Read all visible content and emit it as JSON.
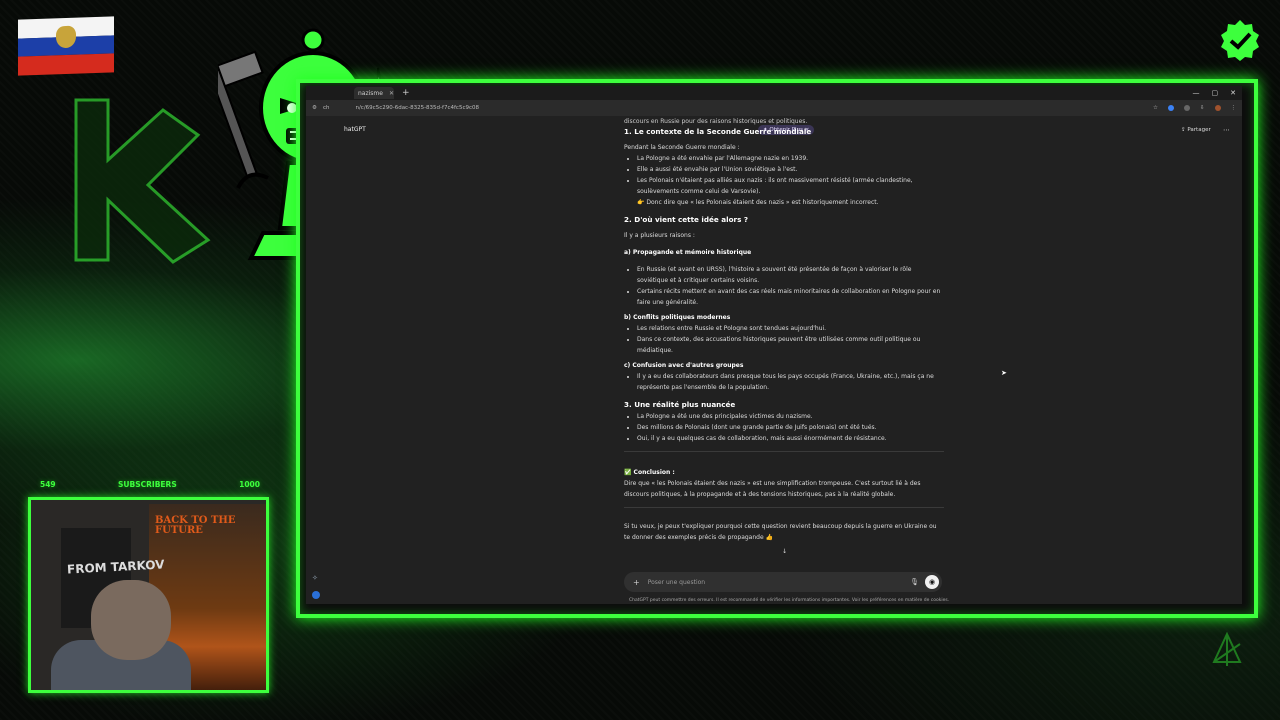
{
  "stream": {
    "subscribers_current": "549",
    "subscribers_label": "SUBSCRIBERS",
    "subscribers_goal": "1000",
    "poster_right_title": "BACK TO THE FUTURE",
    "poster_left_title": "FROM TARKOV"
  },
  "browser": {
    "tab_title": "nazisme",
    "new_tab": "+",
    "url": "n/c/69c5c290-6dac-8325-835d-f7c4fc5c9c08",
    "window_controls": [
      "—",
      "▢",
      "✕"
    ]
  },
  "chat": {
    "app_label": "hatGPT",
    "obtenir_plus": "Obtenir Plus",
    "share_label": "Partager",
    "top_line": "discours en Russie pour des raisons historiques et politiques.",
    "sections": [
      {
        "title": "1. Le contexte de la Seconde Guerre mondiale"
      }
    ],
    "s1_intro": "Pendant la Seconde Guerre mondiale :",
    "s1_items": [
      "La Pologne a été envahie par l'Allemagne nazie en 1939.",
      "Elle a aussi été envahie par l'Union soviétique à l'est.",
      "Les Polonais n'étaient pas alliés aux nazis : ils ont massivement résisté (armée clandestine, soulèvements comme celui de Varsovie).",
      "👉 Donc dire que « les Polonais étaient des nazis » est historiquement incorrect."
    ],
    "s2_title": "2. D'où vient cette idée alors ?",
    "s2_intro": "Il y a plusieurs raisons :",
    "s2a_title": "a) Propagande et mémoire historique",
    "s2a_items": [
      "En Russie (et avant en URSS), l'histoire a souvent été présentée de façon à valoriser le rôle soviétique et à critiquer certains voisins.",
      "Certains récits mettent en avant des cas réels mais minoritaires de collaboration en Pologne pour en faire une généralité."
    ],
    "s2b_title": "b) Conflits politiques modernes",
    "s2b_items": [
      "Les relations entre Russie et Pologne sont tendues aujourd'hui.",
      "Dans ce contexte, des accusations historiques peuvent être utilisées comme outil politique ou médiatique."
    ],
    "s2c_title": "c) Confusion avec d'autres groupes",
    "s2c_items": [
      "Il y a eu des collaborateurs dans presque tous les pays occupés (France, Ukraine, etc.), mais ça ne représente pas l'ensemble de la population."
    ],
    "s3_title": "3. Une réalité plus nuancée",
    "s3_items": [
      "La Pologne a été une des principales victimes du nazisme.",
      "Des millions de Polonais (dont une grande partie de Juifs polonais) ont été tués.",
      "Oui, il y a eu quelques cas de collaboration, mais aussi énormément de résistance."
    ],
    "conclusion_title": "✅ Conclusion :",
    "conclusion_text": "Dire que « les Polonais étaient des nazis » est une simplification trompeuse. C'est surtout lié à des discours politiques, à la propagande et à des tensions historiques, pas à la réalité globale.",
    "followup": "Si tu veux, je peux t'expliquer pourquoi cette question revient beaucoup depuis la guerre en Ukraine ou te donner des exemples précis de propagande 👍",
    "input_placeholder": "Poser une question",
    "disclaimer": "ChatGPT peut commettre des erreurs. Il est recommandé de vérifier les informations importantes. Voir les préférences en matière de cookies."
  },
  "colors": {
    "neon_green": "#3dff3d",
    "flag_white": "#ffffff",
    "flag_blue": "#1c3fa8",
    "flag_red": "#d52b1e"
  }
}
